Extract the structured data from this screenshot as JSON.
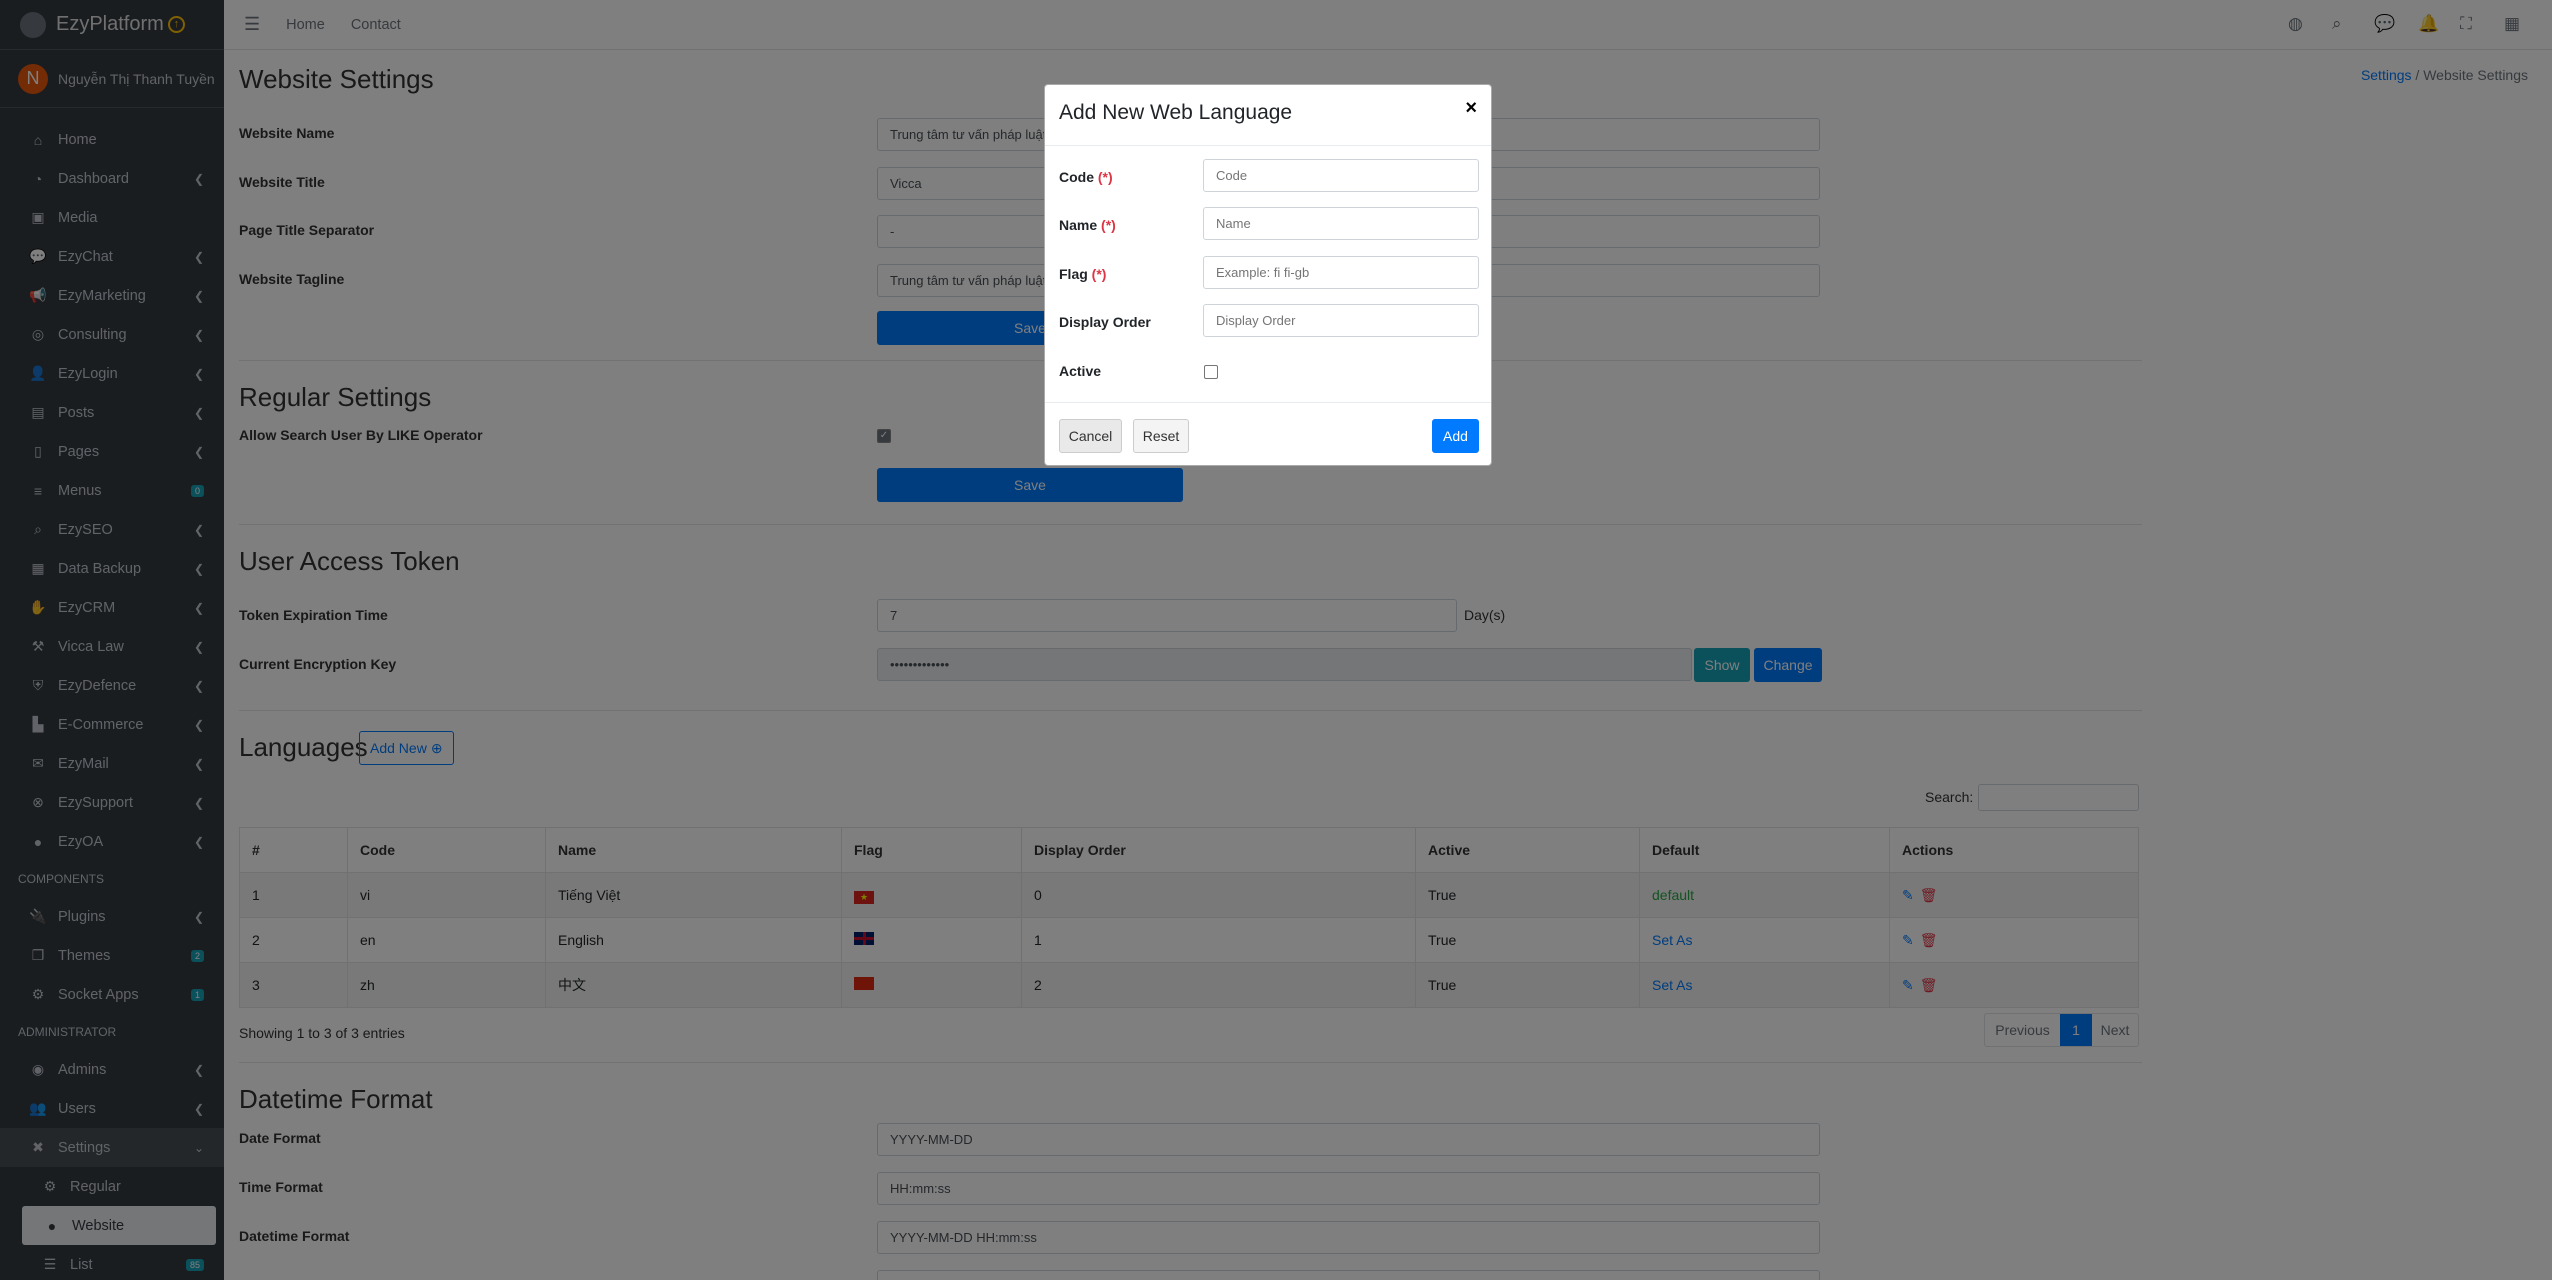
{
  "brand": {
    "name": "EzyPlatform"
  },
  "user": {
    "initial": "N",
    "name": "Nguyễn Thị Thanh Tuyền"
  },
  "sidebar": {
    "items": [
      {
        "label": "Home",
        "icon": "home-icon"
      },
      {
        "label": "Dashboard",
        "icon": "dashboard-icon"
      },
      {
        "label": "Media",
        "icon": "image-icon"
      },
      {
        "label": "EzyChat",
        "icon": "chat-icon"
      },
      {
        "label": "EzyMarketing",
        "icon": "megaphone-icon"
      },
      {
        "label": "Consulting",
        "icon": "globe-icon"
      },
      {
        "label": "EzyLogin",
        "icon": "user-lock-icon"
      },
      {
        "label": "Posts",
        "icon": "posts-icon"
      },
      {
        "label": "Pages",
        "icon": "file-icon"
      },
      {
        "label": "Menus",
        "icon": "menu-icon",
        "badge": "0"
      },
      {
        "label": "EzySEO",
        "icon": "search-icon"
      },
      {
        "label": "Data Backup",
        "icon": "database-icon"
      },
      {
        "label": "EzyCRM",
        "icon": "handshake-icon"
      },
      {
        "label": "Vicca Law",
        "icon": "gavel-icon"
      },
      {
        "label": "EzyDefence",
        "icon": "shield-icon"
      },
      {
        "label": "E-Commerce",
        "icon": "store-icon"
      },
      {
        "label": "EzyMail",
        "icon": "mail-icon"
      },
      {
        "label": "EzySupport",
        "icon": "support-icon"
      },
      {
        "label": "EzyOA",
        "icon": "circle-icon"
      }
    ],
    "components_header": "COMPONENTS",
    "components": [
      {
        "label": "Plugins",
        "icon": "plug-icon"
      },
      {
        "label": "Themes",
        "icon": "themes-icon",
        "badge": "2"
      },
      {
        "label": "Socket Apps",
        "icon": "socket-icon",
        "badge": "1"
      }
    ],
    "admin_header": "ADMINISTRATOR",
    "admin": [
      {
        "label": "Admins",
        "icon": "admin-icon"
      },
      {
        "label": "Users",
        "icon": "users-icon"
      },
      {
        "label": "Settings",
        "icon": "tools-icon"
      }
    ],
    "settings_sub": [
      {
        "label": "Regular",
        "icon": "cogs-icon"
      },
      {
        "label": "Website",
        "icon": "globe-icon"
      },
      {
        "label": "List",
        "icon": "list-icon",
        "badge": "85"
      }
    ]
  },
  "topnav": {
    "links": [
      "Home",
      "Contact"
    ]
  },
  "page": {
    "title": "Website Settings",
    "breadcrumb_root": "Settings",
    "breadcrumb_sep": "/",
    "breadcrumb_current": "Website Settings"
  },
  "website": {
    "name_label": "Website Name",
    "name_value": "Trung tâm tư vấn pháp luật",
    "title_label": "Website Title",
    "title_value": "Vicca",
    "separator_label": "Page Title Separator",
    "separator_value": "-",
    "tagline_label": "Website Tagline",
    "tagline_value": "Trung tâm tư vấn pháp luật",
    "save": "Save"
  },
  "regular": {
    "title": "Regular Settings",
    "like_label": "Allow Search User By LIKE Operator",
    "save": "Save"
  },
  "token": {
    "title": "User Access Token",
    "exp_label": "Token Expiration Time",
    "exp_value": "7",
    "exp_unit": "Day(s)",
    "key_label": "Current Encryption Key",
    "key_value": "•••••••••••••",
    "show": "Show",
    "change": "Change"
  },
  "languages": {
    "title": "Languages",
    "add_new": "Add New",
    "search_label": "Search:",
    "columns": [
      "#",
      "Code",
      "Name",
      "Flag",
      "Display Order",
      "Active",
      "Default",
      "Actions"
    ],
    "rows": [
      {
        "num": "1",
        "code": "vi",
        "name": "Tiếng Việt",
        "order": "0",
        "active": "True",
        "default": "default",
        "flag_color": "#da251d"
      },
      {
        "num": "2",
        "code": "en",
        "name": "English",
        "order": "1",
        "active": "True",
        "default": "Set As",
        "flag_color": "#012169"
      },
      {
        "num": "3",
        "code": "zh",
        "name": "中文",
        "order": "2",
        "active": "True",
        "default": "Set As",
        "flag_color": "#de2910"
      }
    ],
    "showing": "Showing 1 to 3 of 3 entries",
    "prev": "Previous",
    "page": "1",
    "next": "Next"
  },
  "datetime": {
    "title": "Datetime Format",
    "date_label": "Date Format",
    "date_value": "YYYY-MM-DD",
    "time_label": "Time Format",
    "time_value": "HH:mm:ss",
    "datetime_label": "Datetime Format",
    "datetime_value": "YYYY-MM-DD HH:mm:ss"
  },
  "modal": {
    "title": "Add New Web Language",
    "close": "×",
    "code_label": "Code",
    "code_placeholder": "Code",
    "name_label": "Name",
    "name_placeholder": "Name",
    "flag_label": "Flag",
    "flag_placeholder": "Example: fi fi-gb",
    "order_label": "Display Order",
    "order_placeholder": "Display Order",
    "active_label": "Active",
    "required": "(*)",
    "cancel": "Cancel",
    "reset": "Reset",
    "add": "Add"
  },
  "colors": {
    "primary": "#007bff",
    "info": "#17a2b8",
    "sidebar": "#343a40"
  }
}
